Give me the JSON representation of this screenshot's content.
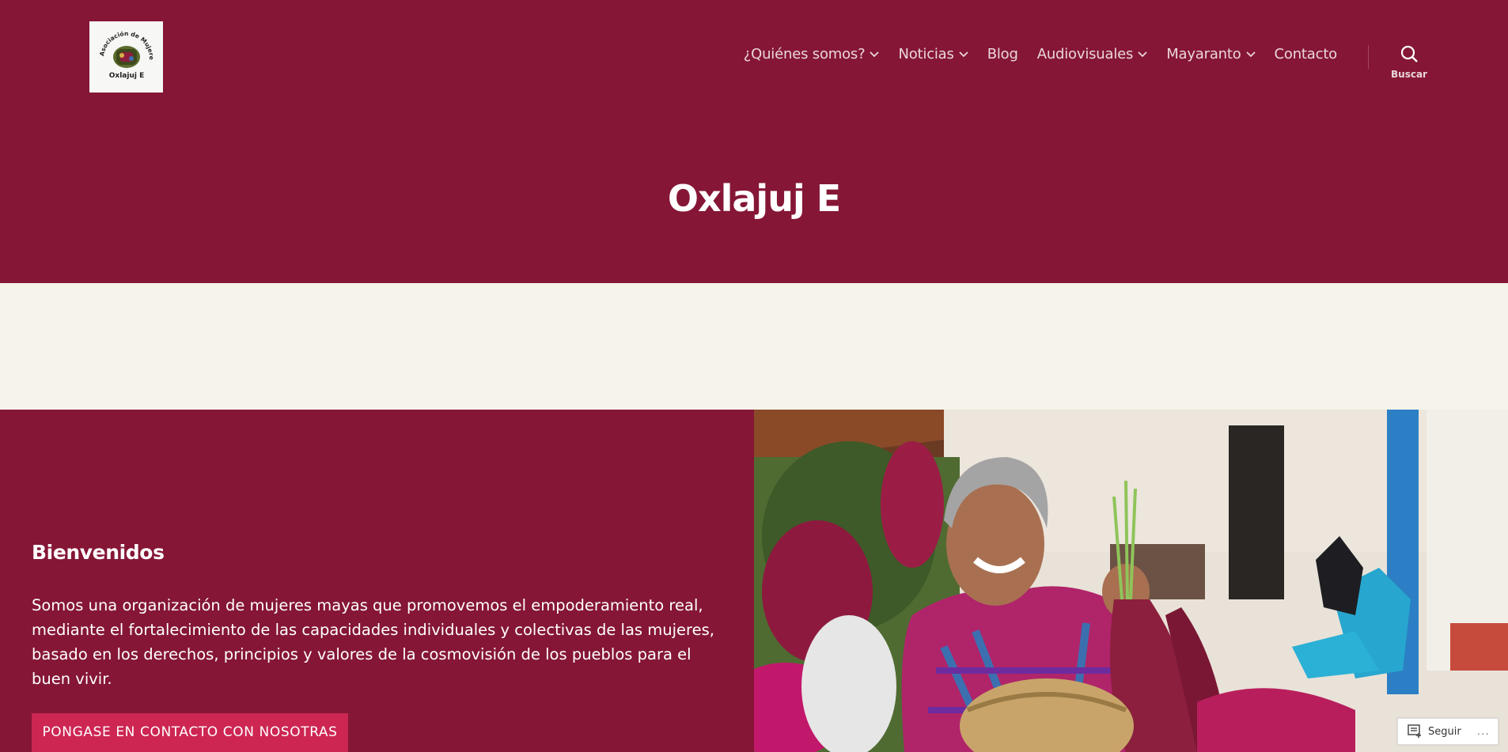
{
  "header": {
    "logo": {
      "arc_text": "Asociación de Mujeres Mayas",
      "name_text": "Oxlajuj E"
    },
    "nav": [
      {
        "label": "¿Quiénes somos?",
        "has_dropdown": true
      },
      {
        "label": "Noticias",
        "has_dropdown": true
      },
      {
        "label": "Blog",
        "has_dropdown": false
      },
      {
        "label": "Audiovisuales",
        "has_dropdown": true
      },
      {
        "label": "Mayaranto",
        "has_dropdown": true
      },
      {
        "label": "Contacto",
        "has_dropdown": false
      }
    ],
    "search_label": "Buscar",
    "site_title": "Oxlajuj E"
  },
  "cover": {
    "title": "Bienvenidos",
    "text": "Somos una organización de mujeres mayas que promovemos el empoderamiento real, mediante el fortalecimiento de las capacidades individuales y colectivas de las mujeres, basado en los derechos, principios y valores de la cosmovisión de los pueblos para el buen vivir.",
    "button_label": "PONGASE EN CONTACTO CON NOSOTRAS"
  },
  "follow": {
    "label": "Seguir",
    "more": "..."
  },
  "colors": {
    "header_bg": "#851636",
    "cream": "#f5f3ea",
    "accent": "#cd2653",
    "nav_text": "#ead7dc"
  }
}
